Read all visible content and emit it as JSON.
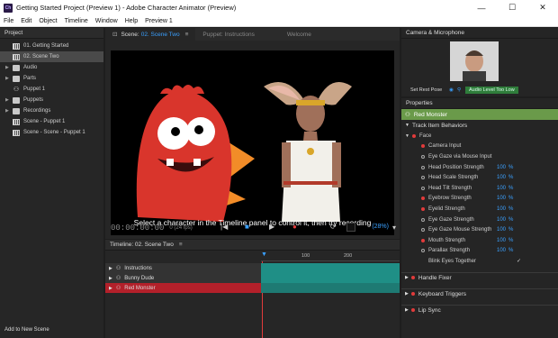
{
  "window": {
    "title": "Getting Started Project (Preview 1) - Adobe Character Animator (Preview)",
    "app_icon": "Ch",
    "minimize": "—",
    "maximize": "☐",
    "close": "✕"
  },
  "menu": [
    "File",
    "Edit",
    "Object",
    "Timeline",
    "Window",
    "Help",
    "Preview 1"
  ],
  "project": {
    "title": "Project",
    "items": [
      {
        "label": "01. Getting Started",
        "type": "scene",
        "twisty": "",
        "selected": false
      },
      {
        "label": "02. Scene Two",
        "type": "scene",
        "twisty": "",
        "selected": true
      },
      {
        "label": "Audio",
        "type": "folder",
        "twisty": "▶",
        "selected": false
      },
      {
        "label": "Parts",
        "type": "folder",
        "twisty": "▶",
        "selected": false
      },
      {
        "label": "Puppet 1",
        "type": "puppet",
        "twisty": "",
        "selected": false
      },
      {
        "label": "Puppets",
        "type": "folder",
        "twisty": "▶",
        "selected": false
      },
      {
        "label": "Recordings",
        "type": "folder",
        "twisty": "▶",
        "selected": false
      },
      {
        "label": "Scene - Puppet 1",
        "type": "scene",
        "twisty": "",
        "selected": false
      },
      {
        "label": "Scene - Scene - Puppet 1",
        "type": "scene",
        "twisty": "",
        "selected": false
      }
    ],
    "add_to_scene": "Add to New Scene"
  },
  "scene": {
    "tab_prefix": "Scene:",
    "tab_name": "02. Scene Two",
    "tab_menu": "≡",
    "tab_puppet": "Puppet: Instructions",
    "tab_welcome": "Welcome",
    "caption": "Select a character in the Timeline panel to control it, then try recording",
    "timecode": "00:00:00:00",
    "frame_info": "0 (24 fps)",
    "zoom": "(28%)",
    "btn_start": "|◀",
    "btn_stop": "■",
    "btn_play": "▶",
    "btn_record": "●",
    "btn_loop": "⟳",
    "btn_zoom": "▾"
  },
  "timeline": {
    "title": "Timeline: 02. Scene Two",
    "title_menu": "≡",
    "ruler": [
      "100",
      "200"
    ],
    "tracks": [
      {
        "name": "Instructions",
        "selected": false
      },
      {
        "name": "Bunny Dude",
        "selected": false
      },
      {
        "name": "Red Monster",
        "selected": true
      }
    ]
  },
  "camera": {
    "title": "Camera & Microphone",
    "set_rest_pose": "Set Rest Pose",
    "audio_level": "Audio Level Too Low"
  },
  "properties": {
    "title": "Properties",
    "selected_item": "Red Monster",
    "section_track": "Track Item Behaviors",
    "face": "Face",
    "rows": [
      {
        "label": "Camera Input",
        "dot": "red",
        "value": "",
        "unit": ""
      },
      {
        "label": "Eye Gaze via Mouse Input",
        "dot": "o",
        "value": "",
        "unit": ""
      },
      {
        "label": "Head Position Strength",
        "dot": "o",
        "value": "100",
        "unit": "%"
      },
      {
        "label": "Head Scale Strength",
        "dot": "o",
        "value": "100",
        "unit": "%"
      },
      {
        "label": "Head Tilt Strength",
        "dot": "o",
        "value": "100",
        "unit": "%"
      },
      {
        "label": "Eyebrow Strength",
        "dot": "red",
        "value": "100",
        "unit": "%"
      },
      {
        "label": "Eyelid Strength",
        "dot": "red",
        "value": "100",
        "unit": "%"
      },
      {
        "label": "Eye Gaze Strength",
        "dot": "o",
        "value": "100",
        "unit": "%"
      },
      {
        "label": "Eye Gaze Mouse Strength",
        "dot": "o",
        "value": "100",
        "unit": "%"
      },
      {
        "label": "Mouth Strength",
        "dot": "red",
        "value": "100",
        "unit": "%"
      },
      {
        "label": "Parallax Strength",
        "dot": "o",
        "value": "100",
        "unit": "%"
      }
    ],
    "blink_together": "Blink Eyes Together",
    "sections": [
      "Handle Fixer",
      "Keyboard Triggers",
      "Lip Sync"
    ]
  },
  "colors": {
    "accent_blue": "#3aa0ff",
    "selected_green": "#6a9a4a",
    "track_teal": "#1f8f86",
    "record_red": "#e23b3b"
  }
}
